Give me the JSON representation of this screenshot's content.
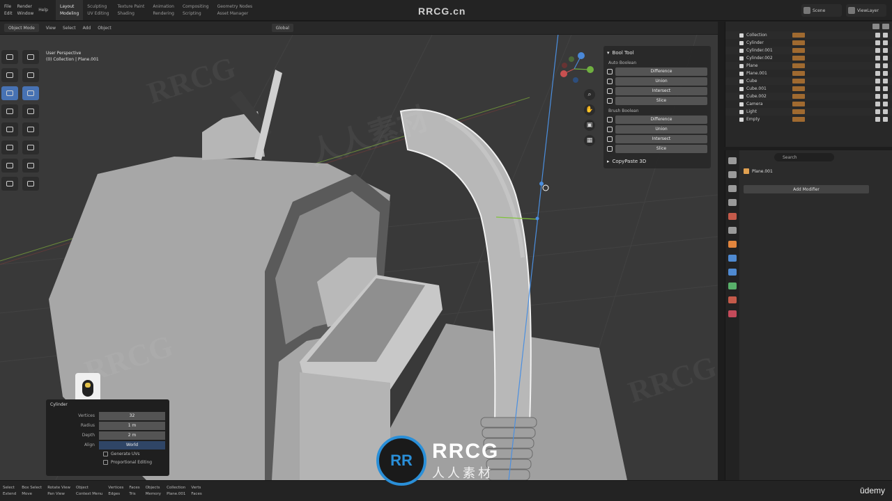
{
  "topbar": {
    "menu_groups": [
      [
        "File",
        "Edit"
      ],
      [
        "Render",
        "Window"
      ],
      [
        "Help"
      ]
    ],
    "workspaces": [
      {
        "line1": "Layout",
        "line2": "Modeling",
        "active": true
      },
      {
        "line1": "Sculpting",
        "line2": "UV Editing"
      },
      {
        "line1": "Texture Paint",
        "line2": "Shading"
      },
      {
        "line1": "Animation",
        "line2": "Rendering"
      },
      {
        "line1": "Compositing",
        "line2": "Scripting"
      },
      {
        "line1": "Geometry Nodes",
        "line2": "Asset Manager"
      }
    ],
    "scene_name": "Scene",
    "view_layer": "ViewLayer"
  },
  "viewport_header": {
    "mode": "Object Mode",
    "menus": [
      "View",
      "Select",
      "Add",
      "Object"
    ],
    "transform_orientation": "Global",
    "overlay_text": [
      "User Perspective",
      "(0) Collection | Plane.001"
    ]
  },
  "bool_tool": {
    "title": "Bool Tool",
    "auto_section": "Auto Boolean",
    "auto_buttons": [
      "Difference",
      "Union",
      "Intersect",
      "Slice"
    ],
    "brush_section": "Brush Boolean",
    "brush_buttons": [
      "Difference",
      "Union",
      "Intersect",
      "Slice"
    ],
    "collapsed_panel": "CopyPaste 3D"
  },
  "redo_panel": {
    "title": "Cylinder",
    "rows": [
      {
        "label": "Vertices",
        "value": "32"
      },
      {
        "label": "Radius",
        "value": "1 m"
      },
      {
        "label": "Depth",
        "value": "2 m"
      }
    ],
    "align_label": "Align",
    "align_value": "World",
    "checks": [
      "Generate UVs",
      "Proportional Editing"
    ]
  },
  "outliner": {
    "rows": [
      "Collection",
      "Cylinder",
      "Cylinder.001",
      "Cylinder.002",
      "Plane",
      "Plane.001",
      "Cube",
      "Cube.001",
      "Cube.002",
      "Camera",
      "Light",
      "Empty"
    ]
  },
  "properties": {
    "search_placeholder": "Search",
    "object_name": "Plane.001",
    "add_modifier": "Add Modifier",
    "tab_colors": [
      "#9a9a9a",
      "#9a9a9a",
      "#9a9a9a",
      "#9a9a9a",
      "#c45a4a",
      "#9a9a9a",
      "#e2853d",
      "#4f8ad1",
      "#4f8ad1",
      "#58b06a",
      "#c45a4a",
      "#c44a5a"
    ]
  },
  "statusbar": {
    "items": [
      [
        "Select",
        "Extend"
      ],
      [
        "Box Select",
        "Move"
      ],
      [
        "Rotate View",
        "Pan View"
      ],
      [
        "Object",
        "Context Menu"
      ],
      [
        "Vertices",
        "Edges"
      ],
      [
        "Faces",
        "Tris"
      ],
      [
        "Objects",
        "Memory"
      ],
      [
        "Collection",
        "Plane.001"
      ],
      [
        "Verts",
        "Faces"
      ]
    ],
    "brand": "ūdemy"
  },
  "watermark": {
    "top": "RRCG.cn",
    "logo_mark": "RR",
    "logo_big": "RRCG",
    "logo_small": "人人素材",
    "faint": [
      "RRCG",
      "人人素材",
      "RRCG",
      "RRCG"
    ]
  },
  "colors": {
    "accent": "#4772b3",
    "viewport_bg": "#393939",
    "mesh_gray": "#a8a8a8",
    "watermark_blue": "#2a8fd8"
  }
}
